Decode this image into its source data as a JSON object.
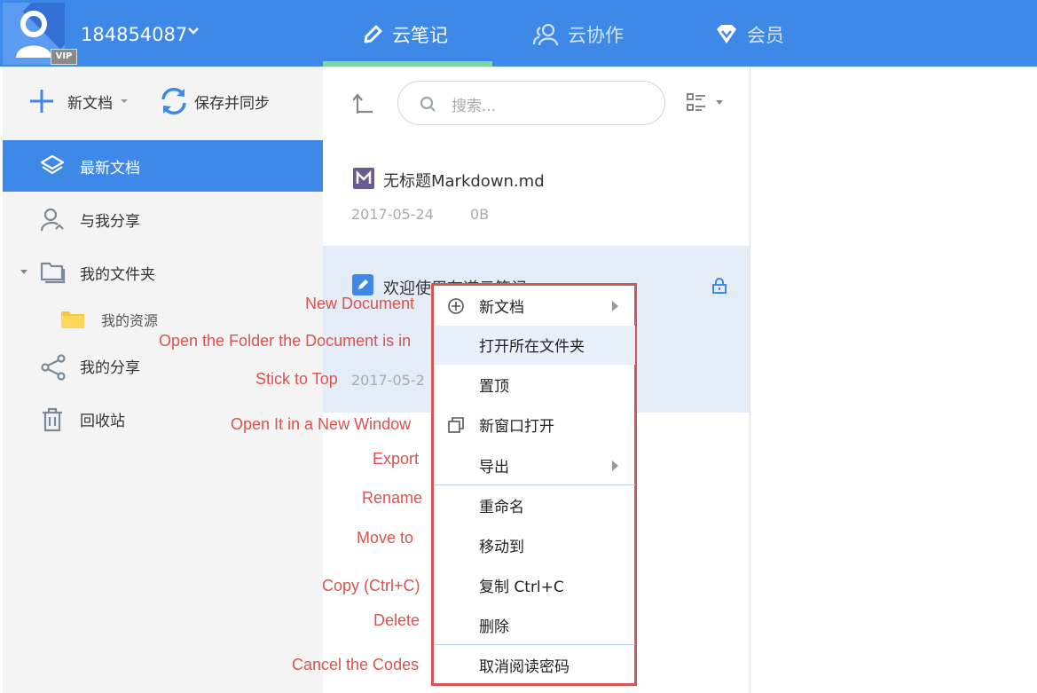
{
  "header": {
    "username": "184854087",
    "vip_badge": "VIP",
    "tabs": [
      {
        "label": "云笔记",
        "icon": "pencil-icon",
        "active": true
      },
      {
        "label": "云协作",
        "icon": "people-icon",
        "active": false
      },
      {
        "label": "会员",
        "icon": "diamond-icon",
        "active": false
      }
    ],
    "accent_color": "#3e89e8",
    "tab_underline_color": "#7dd6a4"
  },
  "toolbar": {
    "new_doc_label": "新文档",
    "save_sync_label": "保存并同步"
  },
  "sidebar": {
    "items": [
      {
        "label": "最新文档",
        "icon": "layers-icon",
        "active": true
      },
      {
        "label": "与我分享",
        "icon": "shared-user-icon",
        "active": false
      },
      {
        "label": "我的文件夹",
        "icon": "folder-outline-icon",
        "active": false
      },
      {
        "label": "我的资源",
        "icon": "folder-icon",
        "active": false
      },
      {
        "label": "我的分享",
        "icon": "share-icon",
        "active": false
      },
      {
        "label": "回收站",
        "icon": "trash-icon",
        "active": false
      }
    ]
  },
  "search": {
    "placeholder": "搜索..."
  },
  "documents": [
    {
      "title": "无标题Markdown.md",
      "date": "2017-05-24",
      "size": "0B",
      "icon": "markdown-icon"
    },
    {
      "title": "欢迎使用有道云笔记",
      "date": "2017-05-2",
      "icon": "note-icon",
      "locked": true
    }
  ],
  "context_menu": {
    "items": [
      {
        "label": "新文档",
        "annotation": "New Document",
        "submenu": true,
        "icon": "plus-circle-icon"
      },
      {
        "label": "打开所在文件夹",
        "annotation": "Open the Folder the Document is in",
        "highlighted": true
      },
      {
        "label": "置顶",
        "annotation": "Stick to Top"
      },
      {
        "label": "新窗口打开",
        "annotation": "Open It in a New Window",
        "icon": "new-window-icon"
      },
      {
        "label": "导出",
        "annotation": "Export",
        "submenu": true
      },
      {
        "label": "重命名",
        "annotation": "Rename"
      },
      {
        "label": "移动到",
        "annotation": "Move to"
      },
      {
        "label": "复制 Ctrl+C",
        "annotation": "Copy (Ctrl+C)"
      },
      {
        "label": "删除",
        "annotation": "Delete"
      },
      {
        "label": "取消阅读密码",
        "annotation": "Cancel the Codes"
      }
    ],
    "border_color": "#d75454",
    "annotation_color": "#d9534f"
  }
}
